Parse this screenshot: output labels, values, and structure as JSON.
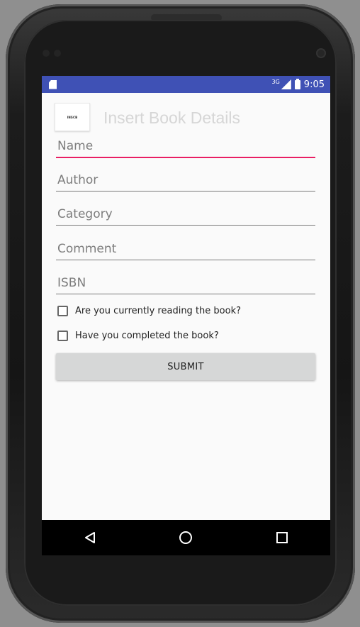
{
  "statusbar": {
    "network": "3G",
    "time": "9:05"
  },
  "header": {
    "app_icon_text": "INSCB",
    "title": "Insert Book Details"
  },
  "form": {
    "name_placeholder": "Name",
    "author_placeholder": "Author",
    "category_placeholder": "Category",
    "comment_placeholder": "Comment",
    "isbn_placeholder": "ISBN",
    "reading_label": "Are you currently reading the book?",
    "completed_label": "Have you completed the book?",
    "submit_label": "SUBMIT"
  },
  "colors": {
    "statusbar": "#3f51b5",
    "accent": "#e91e63",
    "button": "#d6d7d7"
  },
  "navbar": {
    "icons": [
      "back-icon",
      "home-icon",
      "recents-icon"
    ]
  }
}
